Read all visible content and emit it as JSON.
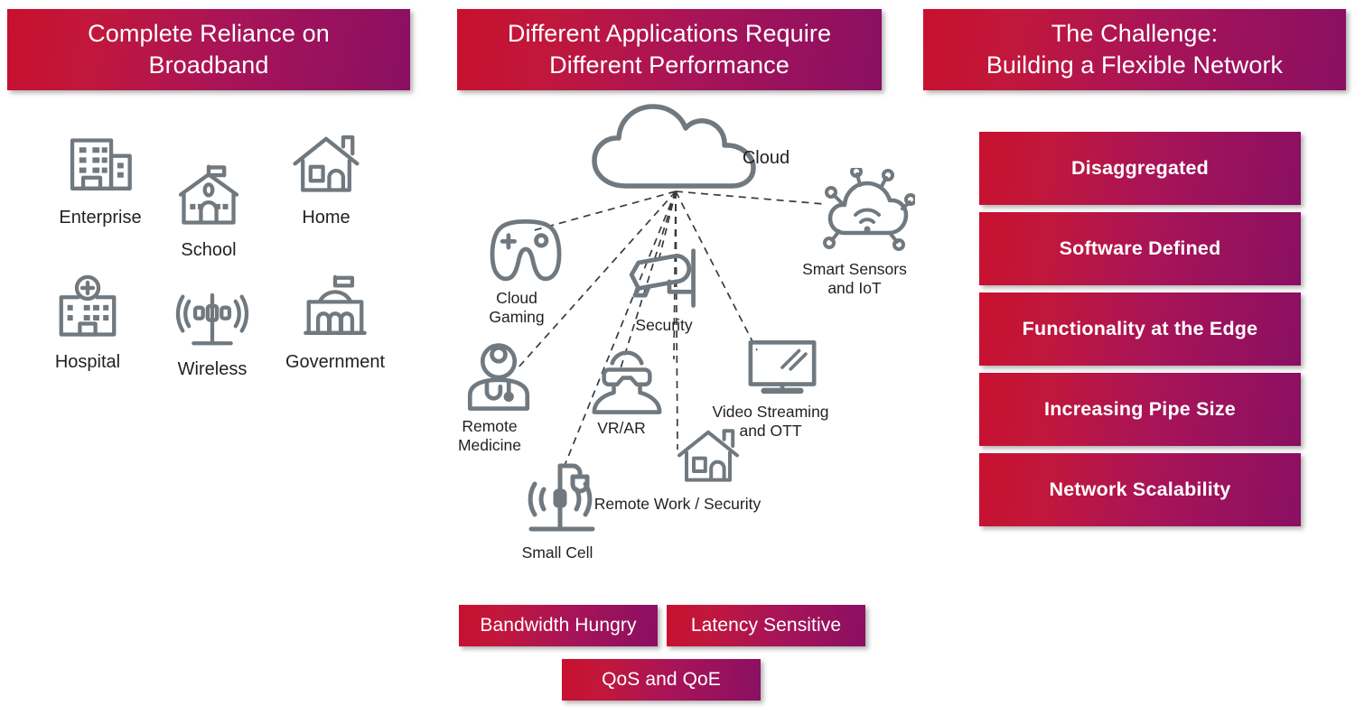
{
  "theme": {
    "gradient_start": "#c8102e",
    "gradient_end": "#8a0f62",
    "icon_gray": "#70797f",
    "text_dark": "#231f20",
    "background": "#ffffff"
  },
  "columns": {
    "left": {
      "header": "Complete Reliance on\nBroadband",
      "items": [
        {
          "label": "Enterprise",
          "icon": "office-building-icon"
        },
        {
          "label": "School",
          "icon": "school-building-icon"
        },
        {
          "label": "Home",
          "icon": "house-icon"
        },
        {
          "label": "Hospital",
          "icon": "hospital-building-icon"
        },
        {
          "label": "Wireless",
          "icon": "cell-tower-icon"
        },
        {
          "label": "Government",
          "icon": "government-building-icon"
        }
      ]
    },
    "center": {
      "header": "Different Applications Require\nDifferent Performance",
      "hub": {
        "label": "Cloud",
        "icon": "cloud-icon"
      },
      "nodes": [
        {
          "label": "Cloud\nGaming",
          "icon": "game-controller-icon"
        },
        {
          "label": "Remote\nMedicine",
          "icon": "doctor-stethoscope-icon"
        },
        {
          "label": "Small Cell",
          "icon": "small-cell-antenna-icon"
        },
        {
          "label": "Security",
          "icon": "cctv-camera-icon"
        },
        {
          "label": "VR/AR",
          "icon": "vr-headset-person-icon"
        },
        {
          "label": "Remote Work / Security",
          "icon": "house-icon"
        },
        {
          "label": "Video Streaming\nand OTT",
          "icon": "television-icon"
        },
        {
          "label": "Smart Sensors\nand IoT",
          "icon": "iot-cloud-sensor-icon"
        }
      ],
      "badges": [
        "Bandwidth Hungry",
        "Latency Sensitive",
        "QoS and QoE"
      ]
    },
    "right": {
      "header": "The Challenge:\nBuilding a Flexible Network",
      "items": [
        "Disaggregated",
        "Software Defined",
        "Functionality at the Edge",
        "Increasing Pipe Size",
        "Network Scalability"
      ]
    }
  }
}
